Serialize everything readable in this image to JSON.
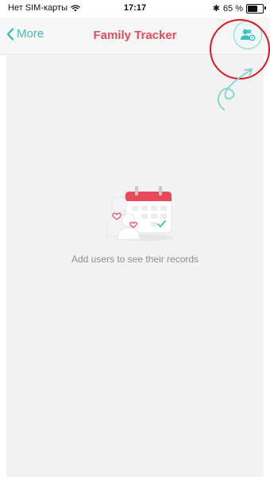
{
  "status_bar": {
    "carrier": "Нет SIM-карты",
    "time": "17:17",
    "battery": "65 %",
    "battery_level": 0.65
  },
  "nav": {
    "back_label": "More",
    "title": "Family Tracker",
    "action_icon": "users-settings-icon"
  },
  "empty_state": {
    "illustration": "calendar-heart-icon",
    "message": "Add users to see their records"
  },
  "colors": {
    "accent_teal": "#3ebeb8",
    "title_red": "#e44b5a",
    "annotation_red": "#e0161f",
    "background": "#f2f2f3"
  }
}
